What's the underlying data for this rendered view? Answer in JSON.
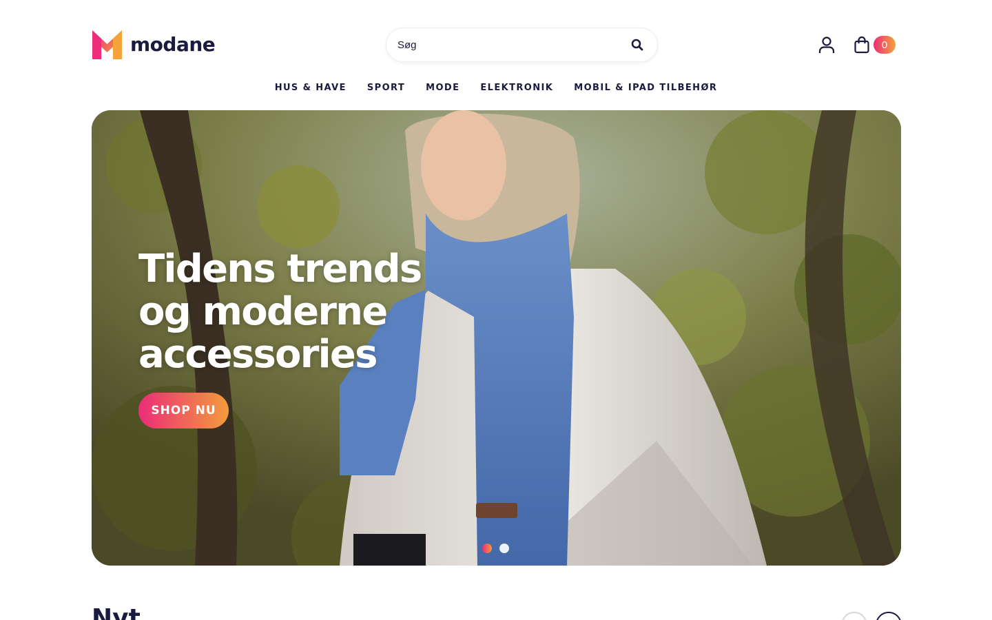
{
  "brand": {
    "name": "modane",
    "colors": {
      "primary": "#1b1a3f",
      "gradient_start": "#ec2d7a",
      "gradient_end": "#f6a23a"
    }
  },
  "header": {
    "search_placeholder": "Søg",
    "search_icon": "search-icon",
    "user_icon": "user-icon",
    "cart_icon": "shopping-bag-icon",
    "cart_count": "0"
  },
  "nav": {
    "items": [
      {
        "label": "HUS & HAVE"
      },
      {
        "label": "SPORT"
      },
      {
        "label": "MODE"
      },
      {
        "label": "ELEKTRONIK"
      },
      {
        "label": "MOBIL & IPAD TILBEHØR"
      }
    ]
  },
  "hero": {
    "title_lines": [
      "Tidens trends",
      "og moderne",
      "accessories"
    ],
    "cta_label": "SHOP NU",
    "slides_total": 2,
    "active_slide": 1
  },
  "section": {
    "title": "Nyt"
  }
}
